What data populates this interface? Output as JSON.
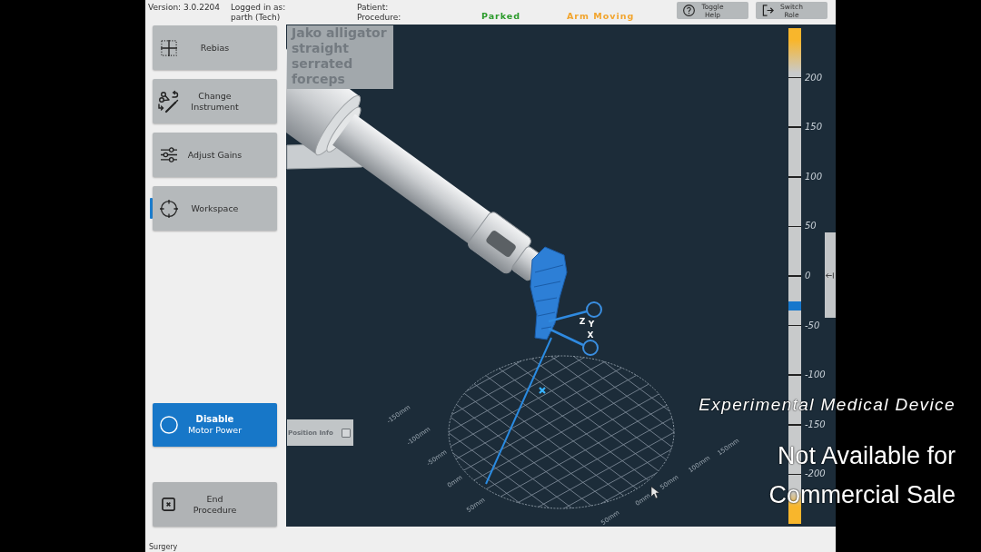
{
  "top_bar": {
    "version": "Version: 3.0.2204",
    "login_label": "Logged in as:",
    "login_user": "parth (Tech)",
    "patient_label": "Patient:",
    "procedure_label": "Procedure:",
    "statuses": [
      {
        "label": "Parked",
        "color": "#2a9a2a"
      },
      {
        "label": "Arm Moving",
        "color": "#f2a52e"
      }
    ],
    "buttons": [
      {
        "label": "Toggle Help"
      },
      {
        "label": "Switch Role"
      }
    ]
  },
  "sidebar": {
    "items": [
      {
        "label": "Rebias",
        "selected": false
      },
      {
        "label": "Change Instrument",
        "selected": false
      },
      {
        "label": "Adjust Gains",
        "selected": false
      },
      {
        "label": "Workspace",
        "selected": true
      }
    ],
    "motor_button": {
      "title": "Disable",
      "subtitle": "Motor Power"
    },
    "end_button": {
      "label": "End Procedure"
    }
  },
  "viewport": {
    "instrument_label": "Jako alligator straight serrated forceps",
    "axis_labels": [
      "Z",
      "Y",
      "X"
    ],
    "grid_labels_left": [
      "-150mm",
      "-100mm",
      "-50mm",
      "0mm",
      "50mm"
    ],
    "grid_labels_right": [
      "50mm",
      "0mm",
      "50mm",
      "100mm",
      "150mm"
    ],
    "position_info": {
      "label": "Position Info",
      "checked": false
    },
    "depth_scale": {
      "ticks": [
        "200",
        "150",
        "100",
        "50",
        "0",
        "-50",
        "-100",
        "-150",
        "-200"
      ],
      "level": 0.44
    }
  },
  "status_bar": {
    "mode": "Surgery"
  },
  "disclaimer": {
    "caption": "Experimental Medical Device",
    "lines": [
      "Not Available for",
      "Commercial Sale"
    ]
  }
}
